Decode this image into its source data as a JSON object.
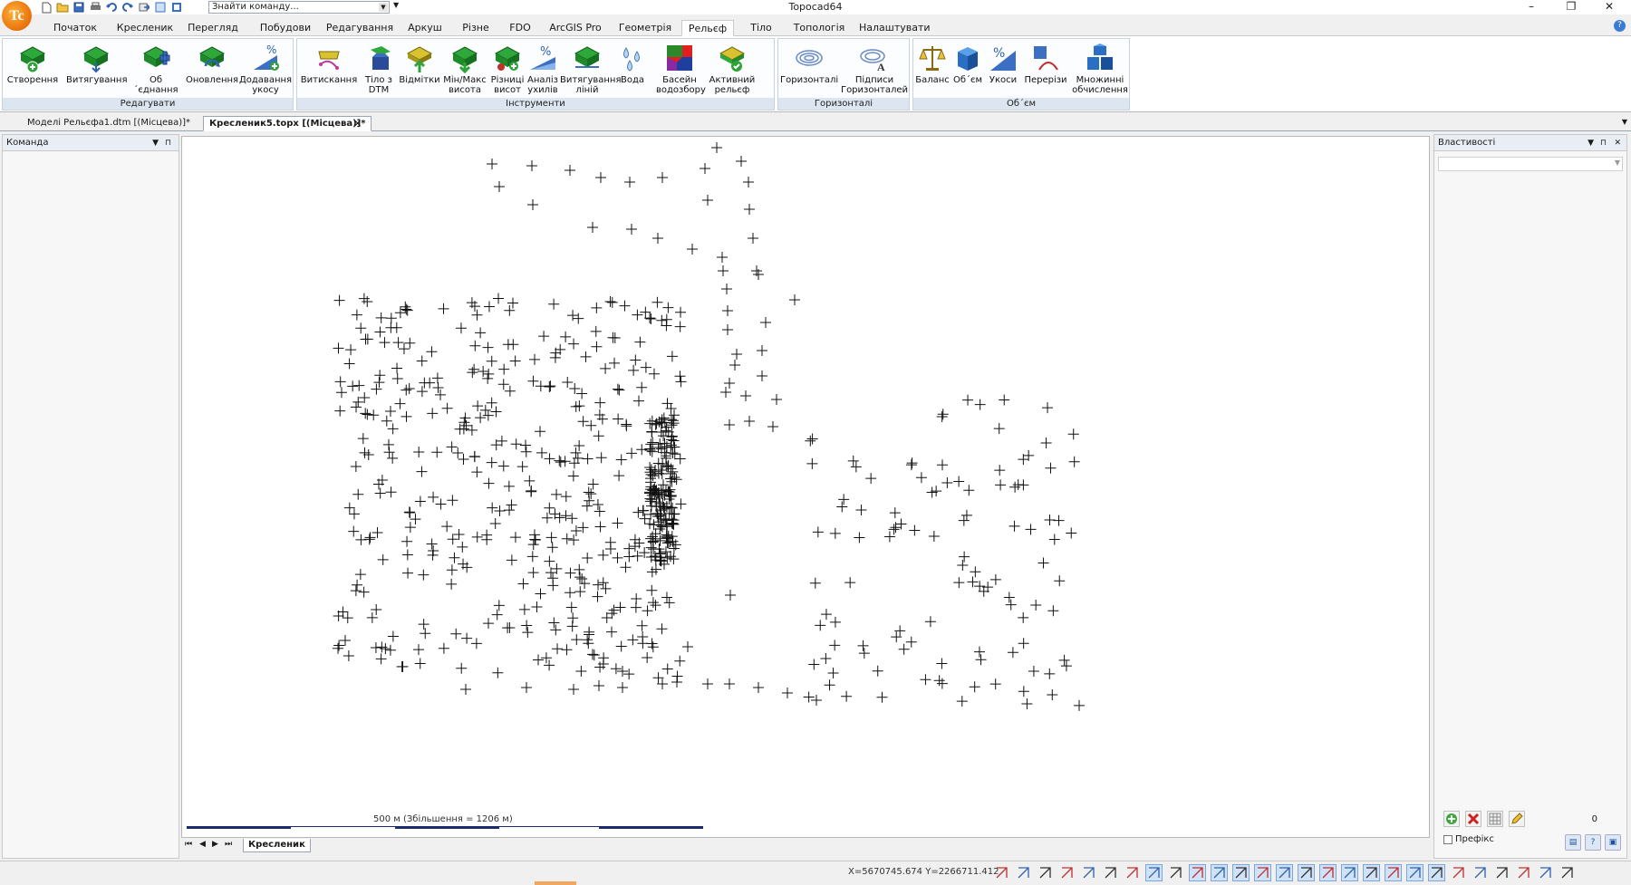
{
  "app": {
    "title": "Topocad64",
    "logo_text": "Tc",
    "command_search_placeholder": "Знайти команду...",
    "window_controls": [
      "–",
      "❐",
      "✕"
    ]
  },
  "ribbon_tabs": [
    {
      "label": "Початок",
      "active": false
    },
    {
      "label": "Кресленик",
      "active": false
    },
    {
      "label": "Перегляд",
      "active": false
    },
    {
      "label": "Побудови",
      "active": false
    },
    {
      "label": "Редагування",
      "active": false
    },
    {
      "label": "Аркуш",
      "active": false
    },
    {
      "label": "Різне",
      "active": false
    },
    {
      "label": "FDO",
      "active": false
    },
    {
      "label": "ArcGIS Pro",
      "active": false
    },
    {
      "label": "Геометрія",
      "active": false
    },
    {
      "label": "Рельєф",
      "active": true
    },
    {
      "label": "Тіло",
      "active": false
    },
    {
      "label": "Топологія",
      "active": false
    },
    {
      "label": "Налаштувати",
      "active": false
    }
  ],
  "ribbon_groups": [
    {
      "label": "Редагувати",
      "buttons": [
        {
          "line1": "Створення",
          "line2": "",
          "icon": "dtm-create-icon"
        },
        {
          "line1": "Витягування",
          "line2": "",
          "icon": "dtm-extract-icon"
        },
        {
          "line1": "Об´єднання",
          "line2": "",
          "icon": "dtm-merge-icon"
        },
        {
          "line1": "Оновлення",
          "line2": "",
          "icon": "dtm-update-icon"
        },
        {
          "line1": "Додавання",
          "line2": "укосу",
          "icon": "add-slope-icon"
        }
      ]
    },
    {
      "label": "Інструменти",
      "buttons": [
        {
          "line1": "Витискання",
          "line2": "",
          "icon": "extrude-icon"
        },
        {
          "line1": "Тіло з",
          "line2": "DTM",
          "icon": "body-from-dtm-icon"
        },
        {
          "line1": "Відмітки",
          "line2": "",
          "icon": "elevations-icon"
        },
        {
          "line1": "Мін/Макс",
          "line2": "висота",
          "icon": "min-max-height-icon"
        },
        {
          "line1": "Різниці",
          "line2": "висот",
          "icon": "height-differences-icon"
        },
        {
          "line1": "Аналіз",
          "line2": "ухилів",
          "icon": "slope-analysis-icon"
        },
        {
          "line1": "Витягування",
          "line2": "ліній",
          "icon": "extract-lines-icon"
        },
        {
          "line1": "Вода",
          "line2": "",
          "icon": "water-drops-icon"
        },
        {
          "line1": "Басейн",
          "line2": "водозбору",
          "icon": "watershed-icon"
        },
        {
          "line1": "Активний",
          "line2": "рельєф",
          "icon": "active-relief-icon"
        }
      ]
    },
    {
      "label": "Горизонталі",
      "buttons": [
        {
          "line1": "Горизонталі",
          "line2": "",
          "icon": "contours-icon"
        },
        {
          "line1": "Підписи",
          "line2": "Горизонталей",
          "icon": "contour-labels-icon"
        }
      ]
    },
    {
      "label": "Об´єм",
      "buttons": [
        {
          "line1": "Баланс",
          "line2": "",
          "icon": "balance-scale-icon"
        },
        {
          "line1": "Об´єм",
          "line2": "",
          "icon": "volume-cube-icon"
        },
        {
          "line1": "Укоси",
          "line2": "",
          "icon": "slopes-percent-icon"
        },
        {
          "line1": "Перерізи",
          "line2": "",
          "icon": "cross-sections-icon"
        },
        {
          "line1": "Множинні",
          "line2": "обчислення",
          "icon": "multiple-calc-icon"
        }
      ]
    }
  ],
  "doc_tabs": [
    {
      "label": "Моделі Рельєфа1.dtm [(Місцева)]*",
      "active": false
    },
    {
      "label": "Кресленик5.topx [(Місцева)]*",
      "active": true
    }
  ],
  "left_panel": {
    "title": "Команда"
  },
  "right_panel": {
    "title": "Властивості",
    "count": "0",
    "prefix_label": "Префікс"
  },
  "canvas": {
    "scale_text": "500 м (Збільшення = 1206 м)",
    "layout_tab": "Кресленик"
  },
  "status": {
    "coords": "X=5670745.674 Y=2266711.412"
  }
}
